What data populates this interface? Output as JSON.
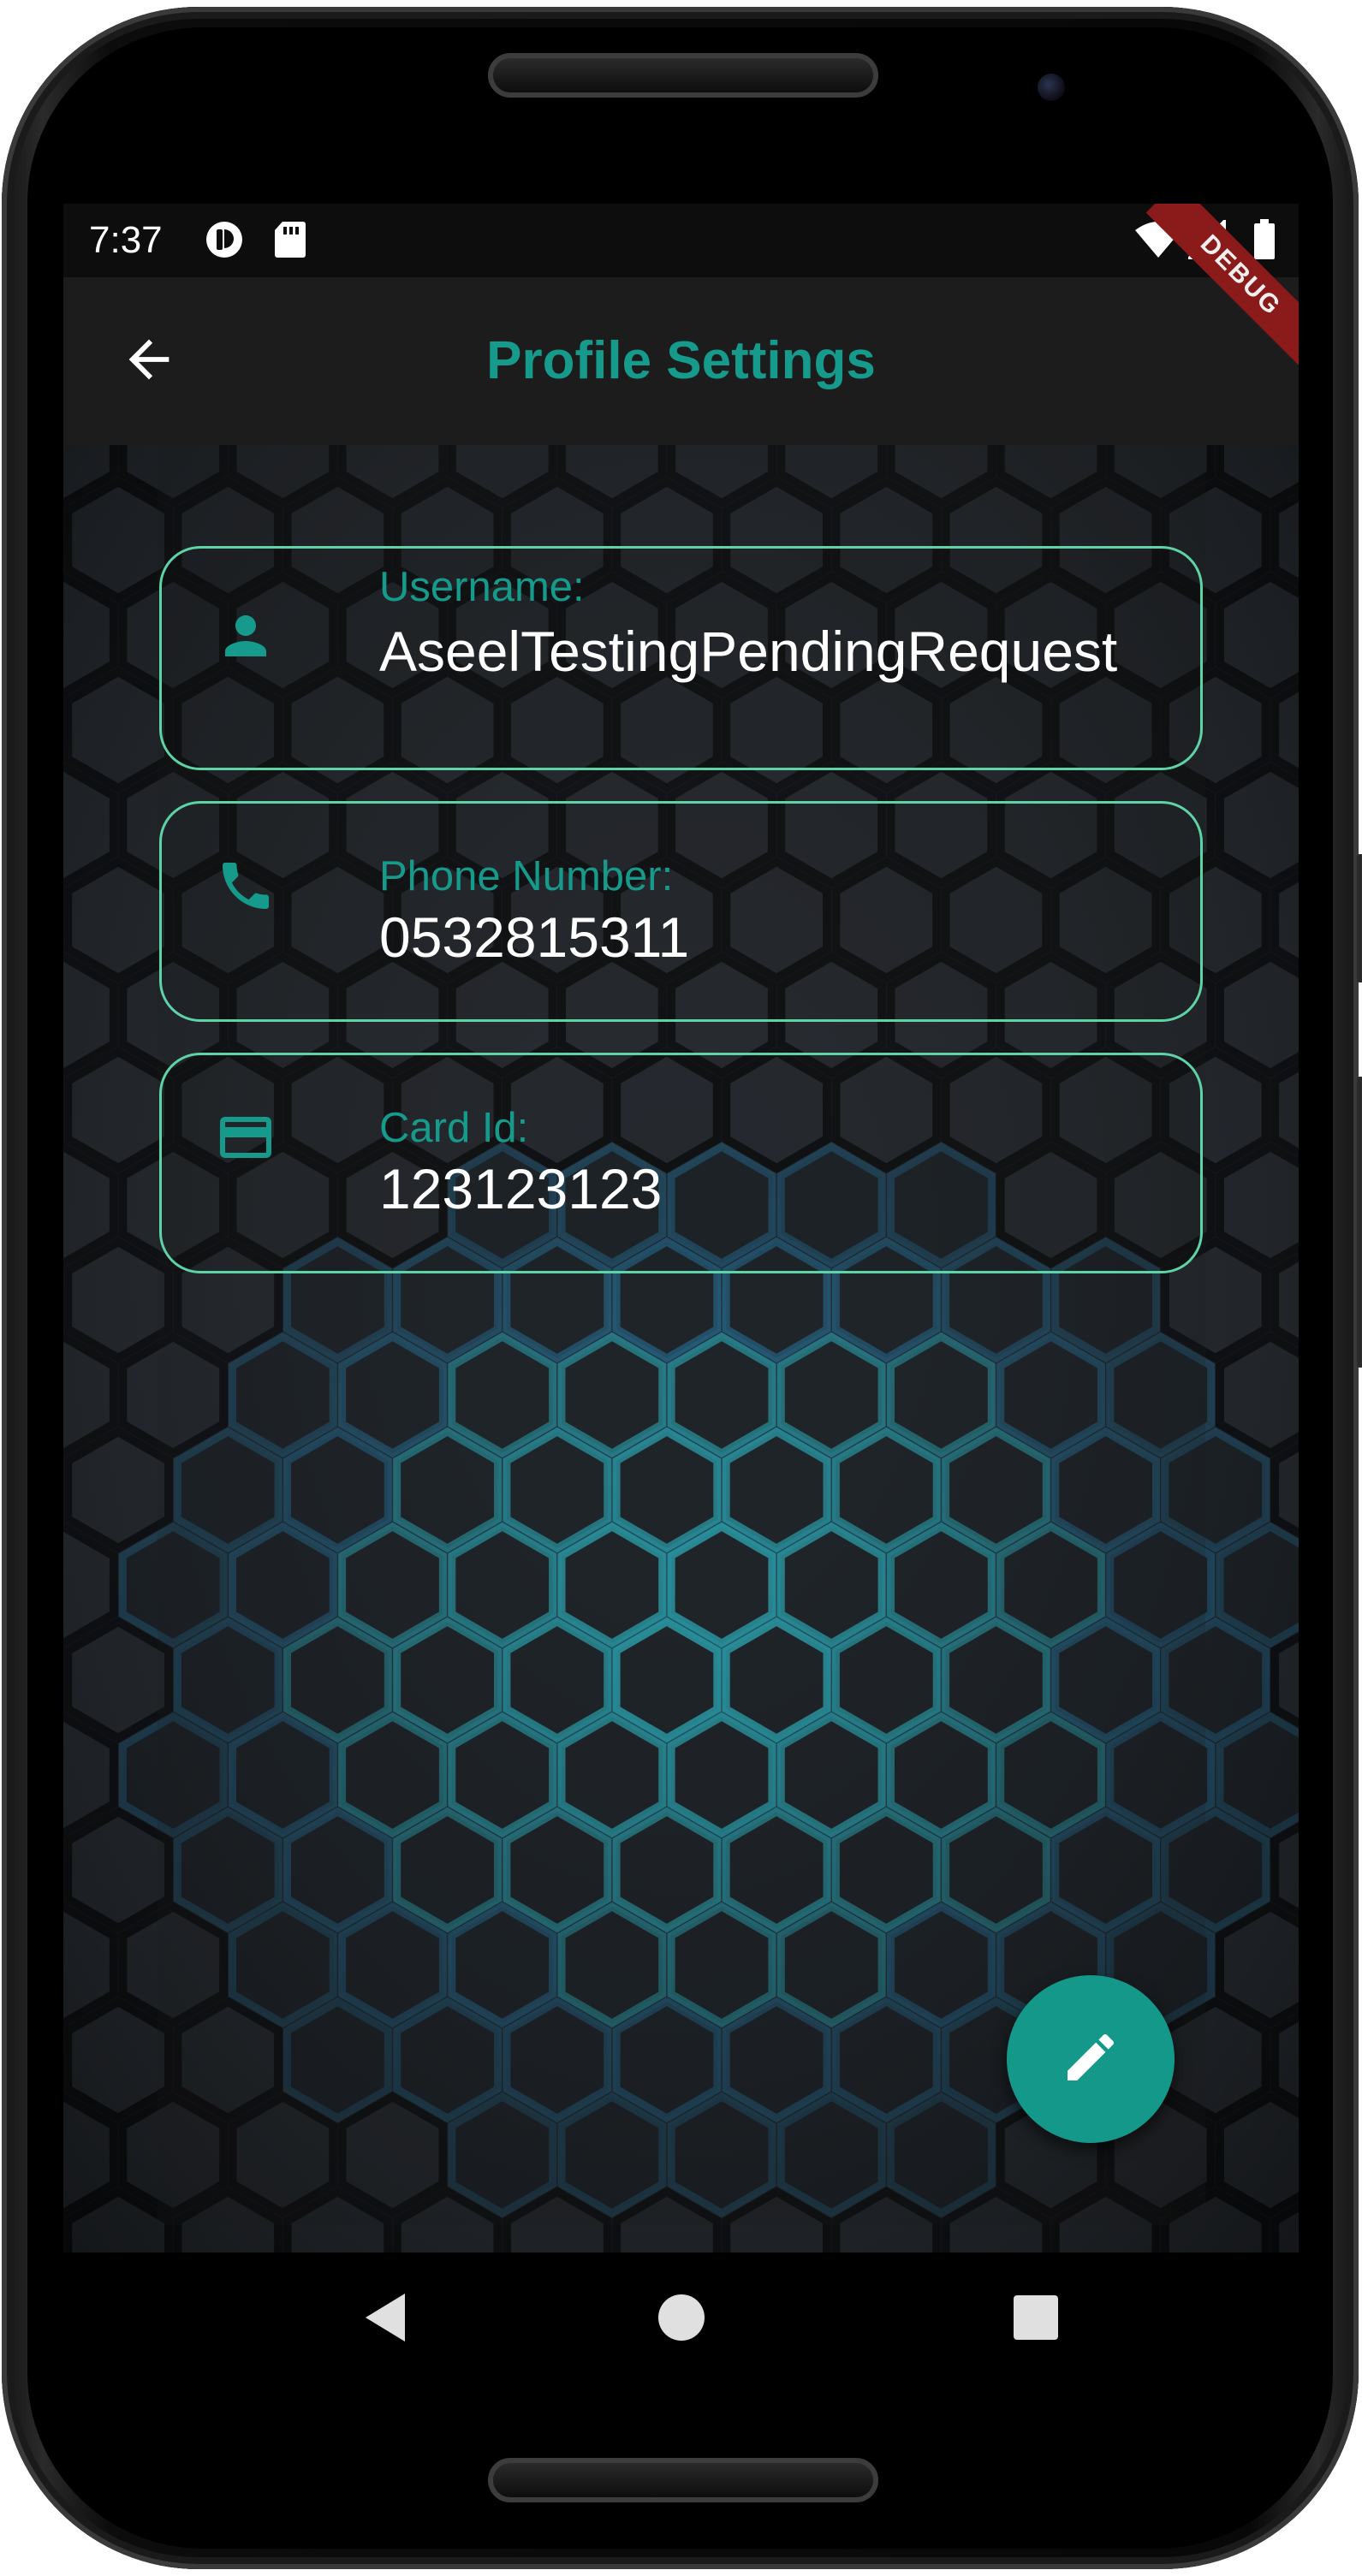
{
  "status_bar": {
    "time": "7:37",
    "left_icons": [
      "app-notification-icon",
      "sd-card-icon"
    ],
    "right_icons": [
      "wifi-icon",
      "cell-signal-icon",
      "battery-icon"
    ]
  },
  "debug_banner": "DEBUG",
  "app_bar": {
    "title": "Profile Settings",
    "back_icon": "arrow-back-icon"
  },
  "profile": {
    "fields": [
      {
        "icon": "person-icon",
        "label": "Username:",
        "value": "AseelTestingPendingRequest"
      },
      {
        "icon": "phone-icon",
        "label": "Phone Number:",
        "value": "0532815311"
      },
      {
        "icon": "credit-card-icon",
        "label": "Card Id:",
        "value": "123123123"
      }
    ]
  },
  "fab": {
    "icon": "edit-pencil-icon"
  },
  "nav_bar": {
    "icons": [
      "nav-back-icon",
      "nav-home-icon",
      "nav-recents-icon"
    ]
  },
  "colors": {
    "accent": "#159a8c",
    "card_border": "#5dd3a6",
    "app_bar": "#1c1c1c",
    "glow": "#1fb6d8"
  }
}
